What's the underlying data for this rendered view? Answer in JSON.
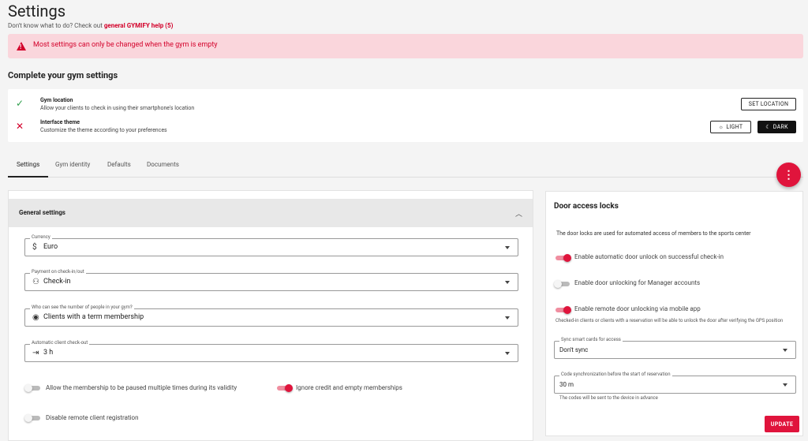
{
  "header": {
    "title": "Settings",
    "help_prefix": "Don't know what to do? Check out ",
    "help_link": "general GYMIFY help (5)"
  },
  "alert": {
    "text": "Most settings can only be changed when the gym is empty"
  },
  "complete": {
    "title": "Complete your gym settings",
    "rows": [
      {
        "title": "Gym location",
        "desc": "Allow your clients to check in using their smartphone's location",
        "status": "done",
        "button": "SET LOCATION"
      },
      {
        "title": "Interface theme",
        "desc": "Customize the theme according to your preferences",
        "status": "todo",
        "light": "LIGHT",
        "dark": "DARK"
      }
    ]
  },
  "tabs": [
    "Settings",
    "Gym identity",
    "Defaults",
    "Documents"
  ],
  "fab": {
    "icon": "more-vertical-icon"
  },
  "general": {
    "title": "General settings",
    "fields": [
      {
        "label": "Currency",
        "value": "Euro",
        "icon": "dollar-icon"
      },
      {
        "label": "Payment on check-in/out",
        "value": "Check-in",
        "icon": "people-icon"
      },
      {
        "label": "Who can see the number of people in your gym?",
        "value": "Clients with a term membership",
        "icon": "eye-icon"
      },
      {
        "label": "Automatic client check-out",
        "value": "3 h",
        "icon": "exit-icon"
      }
    ],
    "toggles": [
      {
        "label": "Allow the membership to be paused multiple times during its validity",
        "on": false
      },
      {
        "label": "Ignore credit and empty memberships",
        "on": true
      },
      {
        "label": "Disable remote client registration",
        "on": false
      }
    ]
  },
  "door": {
    "title": "Door access locks",
    "desc": "The door locks are used for automated access of members to the sports center",
    "toggles": [
      {
        "label": "Enable automatic door unlock on successful check-in",
        "on": true
      },
      {
        "label": "Enable door unlocking for Manager accounts",
        "on": false
      },
      {
        "label": "Enable remote door unlocking via mobile app",
        "on": true
      }
    ],
    "remote_note": "Checked-in clients or clients with a reservation will be able to unlock the door after verifying the GPS position",
    "sync": {
      "label": "Sync smart cards for access",
      "value": "Don't sync"
    },
    "code_sync": {
      "label": "Code synchronization before the start of reservation",
      "value": "30 m",
      "note": "The codes will be sent to the device in advance"
    },
    "update": "UPDATE"
  },
  "colors": {
    "accent": "#e0143c",
    "alert_bg": "#fad6dc",
    "success": "#2e9e4b"
  }
}
